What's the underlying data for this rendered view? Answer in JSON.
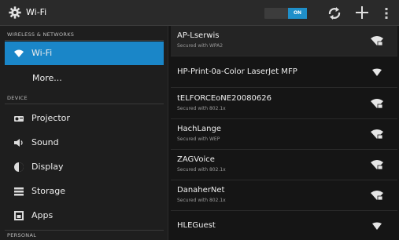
{
  "actionbar": {
    "title": "Wi-Fi",
    "toggle_label": "ON",
    "icons": [
      "settings-gear-icon",
      "wps-sync-icon",
      "add-network-icon",
      "overflow-menu-icon"
    ],
    "accent": "#1f8fc9"
  },
  "sidebar": {
    "headers": [
      "WIRELESS & NETWORKS",
      "DEVICE",
      "PERSONAL"
    ],
    "items": [
      {
        "label": "Wi-Fi",
        "icon": "wifi-icon",
        "active": true
      },
      {
        "label": "More...",
        "icon": ""
      },
      {
        "label": "Projector",
        "icon": "projector-icon"
      },
      {
        "label": "Sound",
        "icon": "speaker-icon"
      },
      {
        "label": "Display",
        "icon": "display-icon"
      },
      {
        "label": "Storage",
        "icon": "storage-icon"
      },
      {
        "label": "Apps",
        "icon": "apps-icon"
      }
    ],
    "active_color": "#1a86c8"
  },
  "networks": [
    {
      "name": "AP-Lserwis",
      "status": "Secured with WPA2",
      "secured": true,
      "selected": true
    },
    {
      "name": "HP-Print-0a-Color LaserJet MFP",
      "status": "",
      "secured": false
    },
    {
      "name": "tELFORCEoNE20080626",
      "status": "Secured with 802.1x",
      "secured": true
    },
    {
      "name": "HachLange",
      "status": "Secured with WEP",
      "secured": true
    },
    {
      "name": "ZAGVoice",
      "status": "Secured with 802.1x",
      "secured": true
    },
    {
      "name": "DanaherNet",
      "status": "Secured with 802.1x",
      "secured": true
    },
    {
      "name": "HLEGuest",
      "status": "",
      "secured": false
    }
  ]
}
